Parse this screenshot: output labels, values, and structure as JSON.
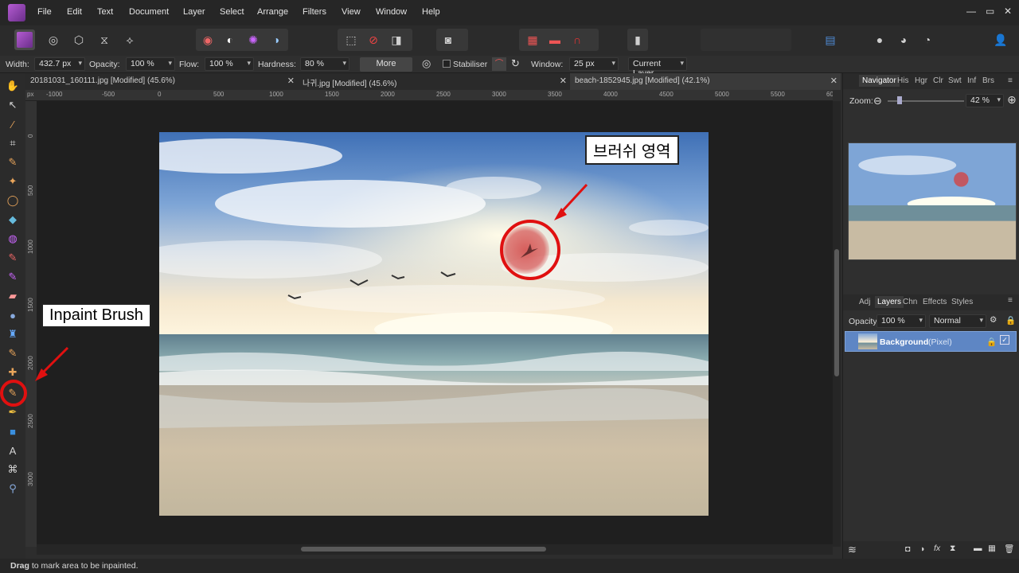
{
  "app": {
    "logo": "affinity-photo-logo"
  },
  "menu": [
    "File",
    "Edit",
    "Text",
    "Document",
    "Layer",
    "Select",
    "Arrange",
    "Filters",
    "View",
    "Window",
    "Help"
  ],
  "window_controls": {
    "minimize": "—",
    "maximize": "▭",
    "close": "✕"
  },
  "context_bar": {
    "width_label": "Width:",
    "width_value": "432.7 px",
    "opacity_label": "Opacity:",
    "opacity_value": "100 %",
    "flow_label": "Flow:",
    "flow_value": "100 %",
    "hardness_label": "Hardness:",
    "hardness_value": "80 %",
    "more_label": "More",
    "stabiliser_label": "Stabiliser",
    "window_label": "Window:",
    "window_value": "25 px",
    "layer_select": "Current Layer"
  },
  "tabs": [
    {
      "title": "20181031_160111.jpg [Modified] (45.6%)",
      "active": false
    },
    {
      "title": "나귀.jpg [Modified] (45.6%)",
      "active": false
    },
    {
      "title": "beach-1852945.jpg [Modified] (42.1%)",
      "active": true
    }
  ],
  "ruler": {
    "unit": "px",
    "top_ticks": [
      "-1000",
      "-500",
      "0",
      "500",
      "1000",
      "1500",
      "2000",
      "2500",
      "3000",
      "3500",
      "4000",
      "4500",
      "5000",
      "5500",
      "60"
    ],
    "left_ticks": [
      "0",
      "500",
      "1000",
      "1500",
      "2000",
      "2500",
      "3000"
    ]
  },
  "annotations": {
    "brush_area": "브러쉬 영역",
    "inpaint_brush": "Inpaint Brush"
  },
  "right_panel": {
    "top_tabs": [
      "Navigator",
      "His",
      "Hgr",
      "Clr",
      "Swt",
      "Inf",
      "Brs"
    ],
    "zoom_label": "Zoom:",
    "zoom_value": "42 %",
    "layer_tabs": [
      "Adj",
      "Layers",
      "Chn",
      "Effects",
      "Styles"
    ],
    "opacity_label": "Opacity:",
    "opacity_value": "100 %",
    "blend_mode": "Normal",
    "layer_name": "Background",
    "layer_type": "(Pixel)"
  },
  "status": {
    "bold": "Drag",
    "text": " to mark area to be inpainted."
  },
  "colors": {
    "accent": "#4f8bd6",
    "annotation_red": "#e01010",
    "selected_layer": "#5e86c4"
  }
}
